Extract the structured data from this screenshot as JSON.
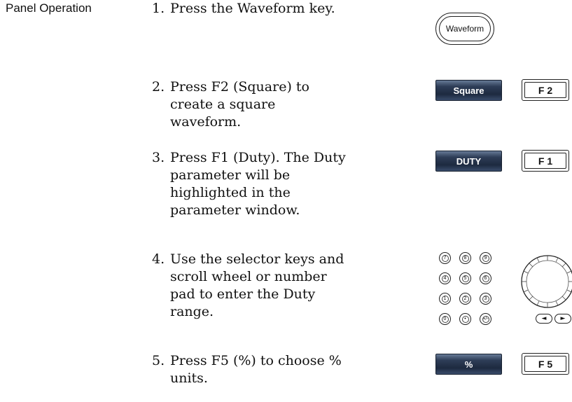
{
  "section_label": "Panel Operation",
  "steps": [
    {
      "number": "1.",
      "text": "Press the Waveform key."
    },
    {
      "number": "2.",
      "text": "Press F2 (Square) to create a square waveform."
    },
    {
      "number": "3.",
      "text": "Press F1 (Duty). The Duty parameter will be highlighted in the parameter window."
    },
    {
      "number": "4.",
      "text": "Use the selector keys and scroll wheel or number pad to enter the Duty range."
    },
    {
      "number": "5.",
      "text": "Press F5 (%) to choose % units."
    }
  ],
  "keys": {
    "waveform": "Waveform",
    "square_softkey": "Square",
    "duty_softkey": "DUTY",
    "percent_softkey": "%",
    "f2": "F 2",
    "f1": "F 1",
    "f5": "F 5"
  },
  "numpad": {
    "rows": [
      [
        "7",
        "8",
        "9"
      ],
      [
        "4",
        "5",
        "6"
      ],
      [
        "1",
        "2",
        "3"
      ],
      [
        "0",
        "•",
        "+/-"
      ]
    ]
  },
  "icons": {
    "scroll_wheel": "scroll-wheel-icon",
    "left_arrow": "left-arrow-key-icon",
    "right_arrow": "right-arrow-key-icon"
  },
  "colors": {
    "softkey_dark": "#1d2a40",
    "softkey_light": "#667a96",
    "text": "#111111"
  }
}
